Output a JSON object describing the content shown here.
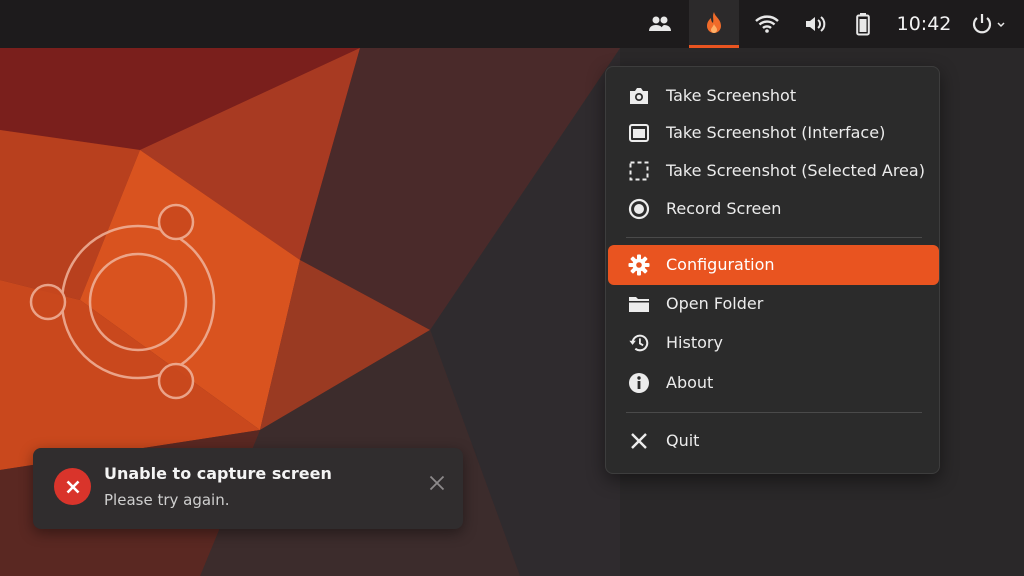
{
  "topbar": {
    "icons": [
      "people-icon",
      "flame-icon",
      "wifi-icon",
      "volume-icon",
      "battery-icon",
      "power-icon"
    ],
    "clock": "10:42",
    "accent_color": "#e95420"
  },
  "menu": {
    "items": [
      {
        "label": "Take Screenshot",
        "icon": "camera-icon"
      },
      {
        "label": "Take Screenshot (Interface)",
        "icon": "window-icon"
      },
      {
        "label": "Take Screenshot (Selected Area)",
        "icon": "selection-icon"
      },
      {
        "label": "Record Screen",
        "icon": "record-icon"
      },
      {
        "label": "Configuration",
        "icon": "gear-icon",
        "selected": true
      },
      {
        "label": "Open Folder",
        "icon": "folder-icon"
      },
      {
        "label": "History",
        "icon": "history-icon"
      },
      {
        "label": "About",
        "icon": "info-icon"
      },
      {
        "label": "Quit",
        "icon": "close-icon"
      }
    ]
  },
  "notification": {
    "title": "Unable to capture screen",
    "message": "Please try again.",
    "icon": "error-icon",
    "status_color": "#d9342b"
  }
}
